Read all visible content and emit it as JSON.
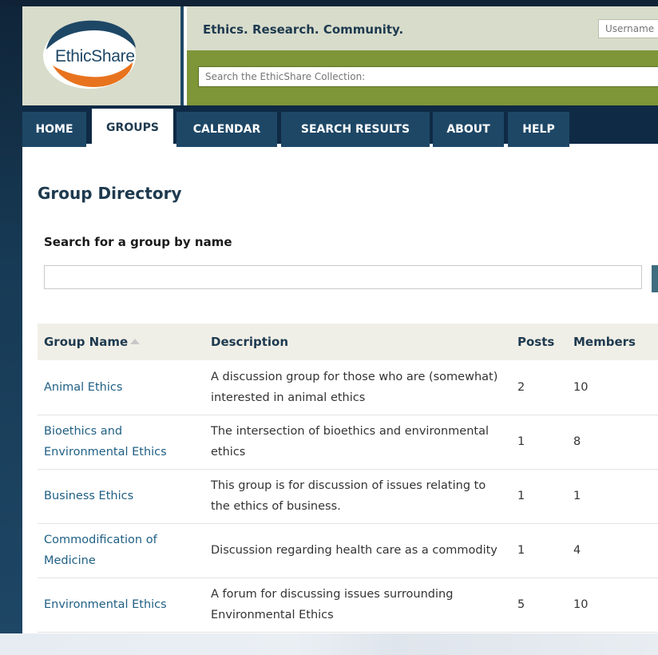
{
  "header": {
    "logo_text": "EthicShare",
    "tagline": "Ethics. Research. Community.",
    "username_placeholder": "Username",
    "collection_search_placeholder": "Search the EthicShare Collection:"
  },
  "nav": {
    "items": [
      {
        "label": "HOME"
      },
      {
        "label": "GROUPS"
      },
      {
        "label": "CALENDAR"
      },
      {
        "label": "SEARCH RESULTS"
      },
      {
        "label": "ABOUT"
      },
      {
        "label": "HELP"
      }
    ],
    "active": "GROUPS"
  },
  "main": {
    "title": "Group Directory",
    "search_label": "Search for a group by name",
    "search_value": ""
  },
  "table": {
    "headers": {
      "name": "Group Name",
      "description": "Description",
      "posts": "Posts",
      "members": "Members"
    },
    "rows": [
      {
        "name": "Animal Ethics",
        "description": "A discussion group for those who are (somewhat) interested in animal ethics",
        "posts": "2",
        "members": "10"
      },
      {
        "name": "Bioethics and Environmental Ethics",
        "description": "The intersection of bioethics and environmental ethics",
        "posts": "1",
        "members": "8"
      },
      {
        "name": "Business Ethics",
        "description": "This group is for discussion of issues relating to the ethics of business.",
        "posts": "1",
        "members": "1"
      },
      {
        "name": "Commodification of Medicine",
        "description": "Discussion regarding health care as a commodity",
        "posts": "1",
        "members": "4"
      },
      {
        "name": "Environmental Ethics",
        "description": "A forum for discussing issues surrounding Environmental Ethics",
        "posts": "5",
        "members": "10"
      }
    ]
  },
  "colors": {
    "navy": "#1e4766",
    "dark_navy": "#0f2a45",
    "olive": "#7e9538",
    "beige": "#d8dccb",
    "orange": "#e8731e",
    "link": "#1f5f84"
  },
  "icons": {
    "logo": "ethicshare-logo-icon",
    "sort": "sort-ascending-icon"
  }
}
